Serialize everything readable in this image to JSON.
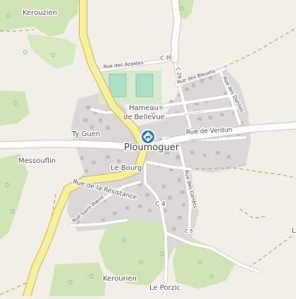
{
  "map": {
    "places": {
      "kerouzien": "Kerouzien",
      "hameau_line1": "Hameau",
      "hameau_line2": "de Bellevue",
      "ty_guen": "Ty Guen",
      "town": "Ploumoguer",
      "messouflin": "Messouflin",
      "le_bourg": "Le Bourg",
      "kerourien": "Kerourien",
      "le_porzic": "Le Porzic"
    },
    "streets": {
      "rue_azalees": "Rue des Azalées",
      "c30": "C 30",
      "c29": "C 29",
      "rue_bleuets": "Rue des Bleuets",
      "rue_dahlias": "Rue des Dahlias",
      "rue_verdun": "Rue de Verdun",
      "rue_resistance": "Rue de la Résistance",
      "rue_genets": "Rue des Genêts",
      "rue_saint_pierre": "Rue Saint-Pierre",
      "c4": "C 4",
      "c5": "C 5",
      "edge_letter": "L"
    },
    "icons": {
      "poi": "directions-icon"
    },
    "colors": {
      "background": "#f1efe7",
      "forest": "#cfe3b4",
      "urban": "#dcd8d8",
      "building": "#c2bebe",
      "sport": "#aadfc4",
      "primary_road": "#f6f09a",
      "poi": "#2d78d4"
    }
  }
}
